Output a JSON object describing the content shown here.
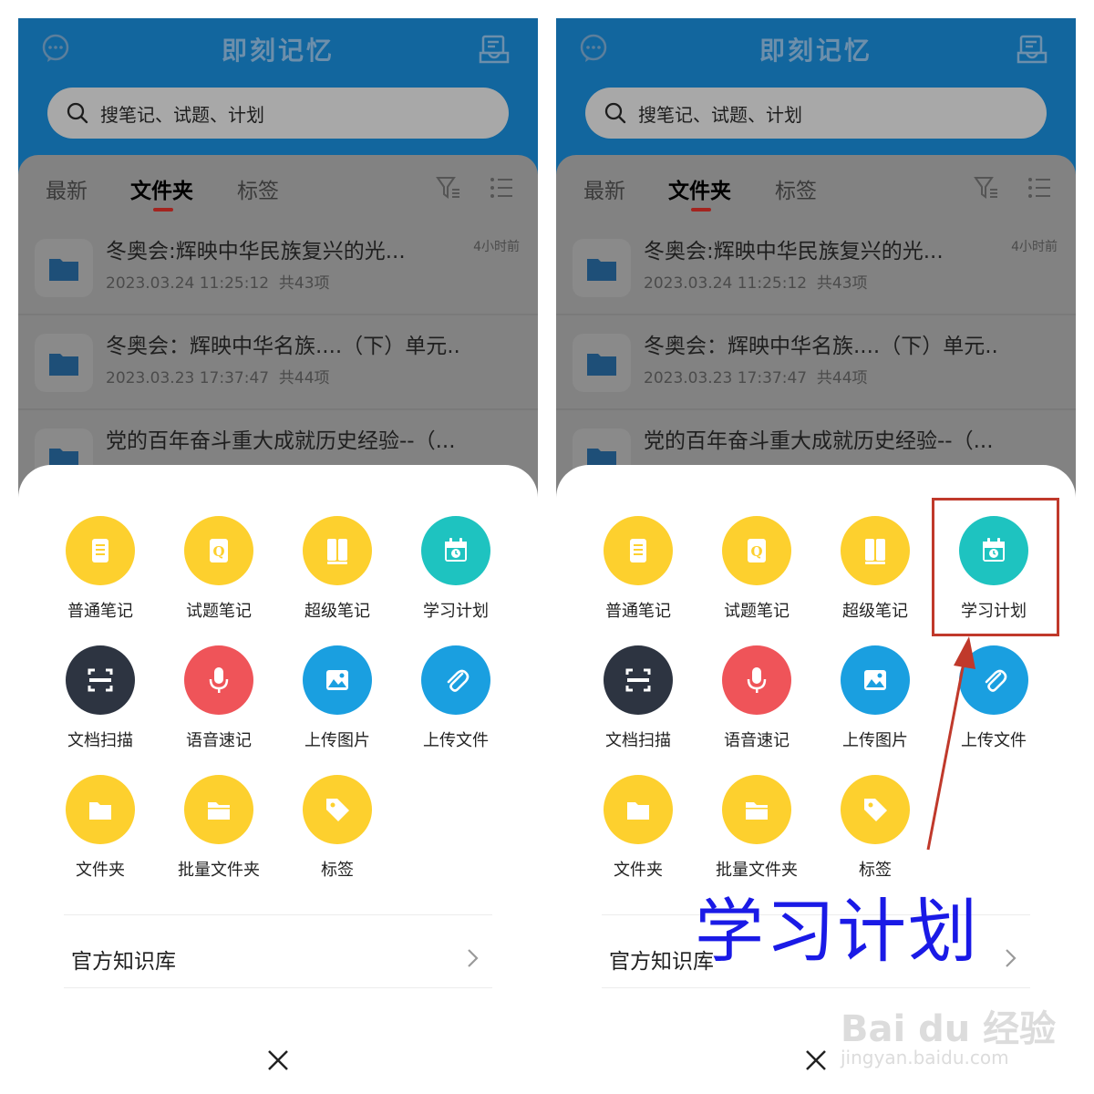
{
  "app": {
    "title": "即刻记忆",
    "search_placeholder": "搜笔记、试题、计划"
  },
  "tabs": [
    {
      "label": "最新",
      "active": false
    },
    {
      "label": "文件夹",
      "active": true
    },
    {
      "label": "标签",
      "active": false
    }
  ],
  "folders": [
    {
      "title": "冬奥会:辉映中华民族复兴的光...",
      "date": "2023.03.24 11:25:12",
      "count": "共43项",
      "time": "4小时前"
    },
    {
      "title": "冬奥会：辉映中华名族....（下）单元...",
      "date": "2023.03.23 17:37:47",
      "count": "共44项",
      "time": ""
    },
    {
      "title": "党的百年奋斗重大成就历史经验--（...",
      "date": "",
      "count": "",
      "time": ""
    }
  ],
  "menu": [
    {
      "label": "普通笔记",
      "icon": "note-icon",
      "color": "#fdd02e"
    },
    {
      "label": "试题笔记",
      "icon": "question-note-icon",
      "color": "#fdd02e"
    },
    {
      "label": "超级笔记",
      "icon": "book-icon",
      "color": "#fdd02e"
    },
    {
      "label": "学习计划",
      "icon": "calendar-icon",
      "color": "#1ec3c0"
    },
    {
      "label": "文档扫描",
      "icon": "scan-icon",
      "color": "#2d3441"
    },
    {
      "label": "语音速记",
      "icon": "microphone-icon",
      "color": "#ef5459"
    },
    {
      "label": "上传图片",
      "icon": "image-icon",
      "color": "#1a9fe0"
    },
    {
      "label": "上传文件",
      "icon": "paperclip-icon",
      "color": "#1a9fe0"
    },
    {
      "label": "文件夹",
      "icon": "folder-icon",
      "color": "#fdd02e"
    },
    {
      "label": "批量文件夹",
      "icon": "batch-folder-icon",
      "color": "#fdd02e"
    },
    {
      "label": "标签",
      "icon": "tag-icon",
      "color": "#fdd02e"
    }
  ],
  "knowledge_base": {
    "label": "官方知识库"
  },
  "annotation": {
    "text": "学习计划",
    "box_color": "#c0392b",
    "text_color": "#1a1ae6"
  },
  "watermark": {
    "logo": "Bai du 经验",
    "url": "jingyan.baidu.com"
  }
}
